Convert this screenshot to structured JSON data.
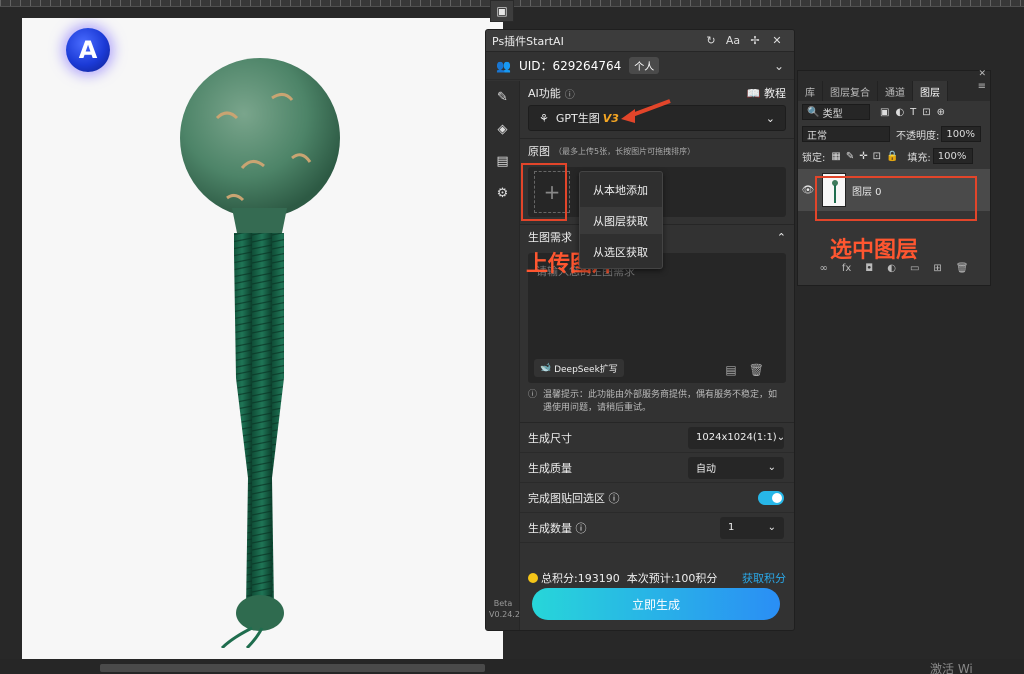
{
  "panel": {
    "title": "Ps插件StartAI",
    "title_icons": [
      "refresh-icon",
      "font-size-icon",
      "pin-icon",
      "close-icon"
    ],
    "title_icon_glyphs": [
      "↻",
      "Aa",
      "✢",
      "✕"
    ],
    "uid": "UID：629264764",
    "account_badge": "个人",
    "nav_icons": [
      "brush-icon",
      "layers-icon",
      "clipboard-icon",
      "gear-icon"
    ],
    "version_line1": "Beta",
    "version_line2": "V0.24.2"
  },
  "ai_function": {
    "label": "AI功能",
    "tutorial": "教程",
    "model": "GPT生图",
    "model_version": "V3"
  },
  "source_image": {
    "label": "原图",
    "hint": "（最多上传5张，长按图片可拖拽排序）",
    "plus": "+"
  },
  "upload_menu": {
    "items": [
      "从本地添加",
      "从图层获取",
      "从选区获取"
    ]
  },
  "prompt": {
    "label": "生图需求",
    "placeholder": "请输入您的生图需求",
    "deepseek_label": "DeepSeek扩写"
  },
  "tip": "温馨提示：此功能由外部服务商提供，偶有服务不稳定，如遇使用问题，请稍后重试。",
  "settings": {
    "size_label": "生成尺寸",
    "size_value": "1024x1024(1:1)",
    "quality_label": "生成质量",
    "quality_value": "自动",
    "paste_back_label": "完成图贴回选区",
    "paste_back_on": true,
    "count_label": "生成数量",
    "count_value": "1"
  },
  "footer": {
    "total_points": "总积分:193190",
    "estimate": "本次预计:100积分",
    "get_points": "获取积分",
    "generate_button": "立即生成"
  },
  "annotations": {
    "upload_text": "上传图片",
    "select_layer_text": "选中图层",
    "color": "#e2452a"
  },
  "layers_panel": {
    "tabs": [
      "库",
      "图层复合",
      "通道",
      "图层"
    ],
    "active_tab": "图层",
    "filter": "类型",
    "blend_mode": "正常",
    "opacity_label": "不透明度:",
    "opacity_value": "100%",
    "lock_label": "锁定:",
    "fill_label": "填充:",
    "fill_value": "100%",
    "layer_name": "图层 0",
    "bottom_icons": [
      "link-icon",
      "fx-icon",
      "mask-icon",
      "adjustment-icon",
      "folder-icon",
      "new-layer-icon",
      "trash-icon"
    ],
    "bottom_glyphs": [
      "∞",
      "fx",
      "◘",
      "◐",
      "▭",
      "⊞",
      "🗑"
    ]
  },
  "brand_logo_letter": "A",
  "status_watermark": "激活 Wi"
}
